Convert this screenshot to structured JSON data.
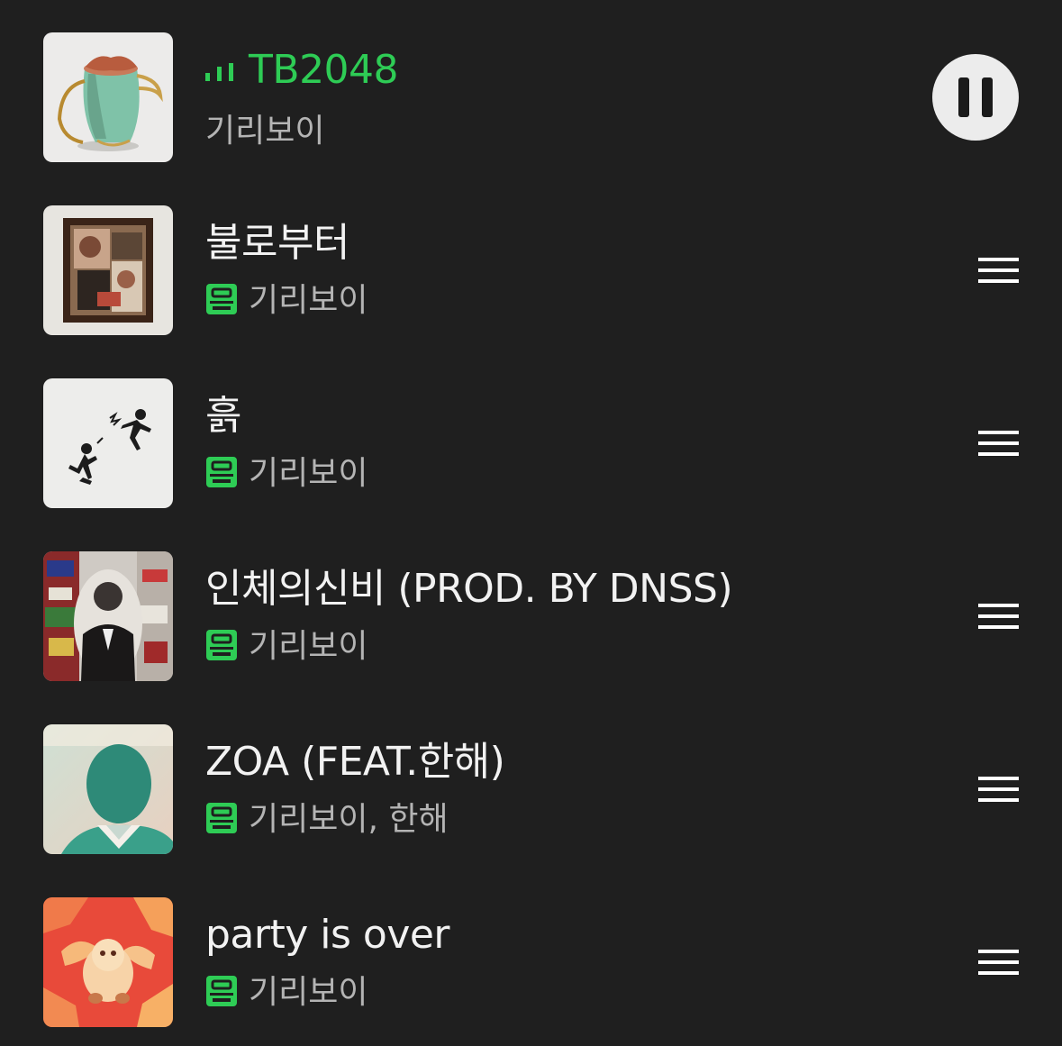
{
  "accent_color": "#2ecc55",
  "background_color": "#1f1f1f",
  "queue": {
    "now_playing": {
      "title": "TB2048",
      "artist": "기리보이",
      "status_icon": "equalizer-icon",
      "control_icon": "pause-icon"
    },
    "tracks": [
      {
        "title": "불로부터",
        "artist": "기리보이",
        "badge_icon": "lyrics-icon",
        "handle_icon": "drag-handle-icon"
      },
      {
        "title": "흙",
        "artist": "기리보이",
        "badge_icon": "lyrics-icon",
        "handle_icon": "drag-handle-icon"
      },
      {
        "title": "인체의신비 (PROD. BY DNSS)",
        "artist": "기리보이",
        "badge_icon": "lyrics-icon",
        "handle_icon": "drag-handle-icon"
      },
      {
        "title": "ZOA (FEAT.한해)",
        "artist": "기리보이, 한해",
        "badge_icon": "lyrics-icon",
        "handle_icon": "drag-handle-icon"
      },
      {
        "title": "party is over",
        "artist": "기리보이",
        "badge_icon": "lyrics-icon",
        "handle_icon": "drag-handle-icon"
      }
    ]
  }
}
